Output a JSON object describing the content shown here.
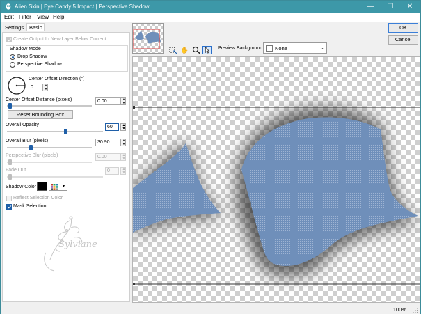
{
  "window": {
    "title": "Alien Skin | Eye Candy 5 Impact | Perspective Shadow",
    "controls": {
      "minimize": "—",
      "maximize": "☐",
      "close": "✕"
    }
  },
  "menu": {
    "items": [
      "Edit",
      "Filter",
      "View",
      "Help"
    ]
  },
  "tabs": [
    "Settings",
    "Basic"
  ],
  "settings": {
    "create_output_label": "Create Output In New Layer Below Current",
    "create_output_checked": true,
    "shadow_mode_label": "Shadow Mode",
    "drop_shadow_label": "Drop Shadow",
    "perspective_shadow_label": "Perspective Shadow",
    "shadow_mode_selected": "Drop Shadow",
    "center_offset_direction_label": "Center Offset Direction (°)",
    "center_offset_direction_value": "0",
    "center_offset_distance_label": "Center Offset Distance (pixels)",
    "center_offset_distance_value": "0.00",
    "reset_bounding_box_label": "Reset Bounding Box",
    "overall_opacity_label": "Overall Opacity",
    "overall_opacity_value": "60",
    "overall_opacity_level": 0.6,
    "overall_blur_label": "Overall Blur (pixels)",
    "overall_blur_value": "30.90",
    "perspective_blur_label": "Perspective Blur (pixels)",
    "perspective_blur_value": "0.00",
    "fade_out_label": "Fade Out",
    "fade_out_value": "0",
    "shadow_color_label": "Shadow Color",
    "shadow_color": "#000000",
    "reflect_selection_label": "Reflect Selection Color",
    "reflect_selection_checked": false,
    "mask_selection_label": "Mask Selection",
    "mask_selection_checked": true
  },
  "watermark_text": "Sylviane",
  "buttons": {
    "ok": "OK",
    "cancel": "Cancel"
  },
  "toolbar": {
    "icons": [
      "bounding-box-tool-icon",
      "hand-tool-icon",
      "zoom-tool-icon",
      "pointer-tool-icon"
    ],
    "active": "pointer-tool-icon"
  },
  "preview_background": {
    "label": "Preview Background:",
    "value": "None"
  },
  "status": {
    "zoom": "100%"
  },
  "colors": {
    "titlebar": "#3d98a8",
    "accent": "#1f5fa8",
    "shape_fill": "#6f8fba"
  }
}
